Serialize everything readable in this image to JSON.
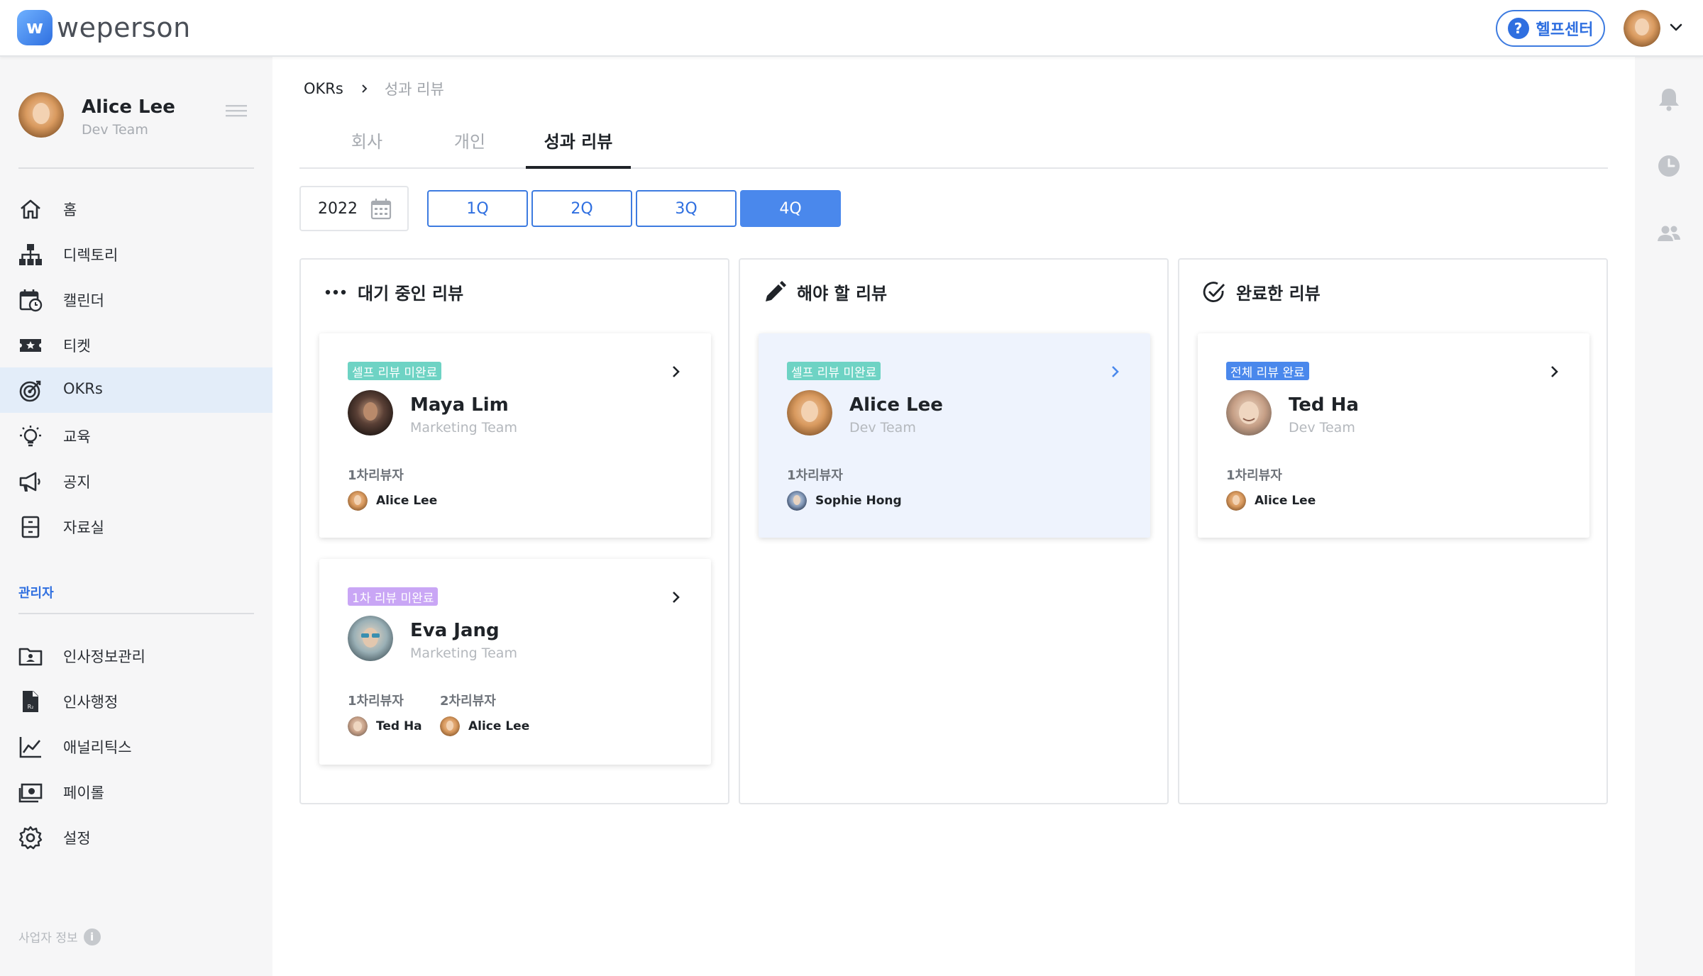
{
  "header": {
    "logo_text": "weperson",
    "help_label": "헬프센터"
  },
  "sidebar": {
    "profile": {
      "name": "Alice Lee",
      "team": "Dev Team"
    },
    "items": [
      {
        "label": "홈",
        "icon": "home-icon"
      },
      {
        "label": "디렉토리",
        "icon": "org-chart-icon"
      },
      {
        "label": "캘린더",
        "icon": "calendar-clock-icon"
      },
      {
        "label": "티켓",
        "icon": "ticket-star-icon"
      },
      {
        "label": "OKRs",
        "icon": "target-icon",
        "active": true
      },
      {
        "label": "교육",
        "icon": "lightbulb-icon"
      },
      {
        "label": "공지",
        "icon": "megaphone-icon"
      },
      {
        "label": "자료실",
        "icon": "cabinet-icon"
      }
    ],
    "admin_section": "관리자",
    "admin_items": [
      {
        "label": "인사정보관리",
        "icon": "id-folder-icon"
      },
      {
        "label": "인사행정",
        "icon": "document-icon"
      },
      {
        "label": "애널리틱스",
        "icon": "line-chart-icon"
      },
      {
        "label": "페이롤",
        "icon": "money-icon"
      },
      {
        "label": "설정",
        "icon": "gear-icon"
      }
    ],
    "footer": "사업자 정보"
  },
  "breadcrumb": {
    "root": "OKRs",
    "current": "성과 리뷰"
  },
  "tabs": [
    {
      "label": "회사"
    },
    {
      "label": "개인"
    },
    {
      "label": "성과 리뷰",
      "active": true
    }
  ],
  "filters": {
    "year": "2022",
    "quarters": [
      "1Q",
      "2Q",
      "3Q",
      "4Q"
    ],
    "selected_quarter": "4Q"
  },
  "columns": [
    {
      "title": "대기 중인 리뷰",
      "icon": "more-dots-icon",
      "cards": [
        {
          "badge": "셀프 리뷰 미완료",
          "badge_color": "#6ed3c4",
          "name": "Maya Lim",
          "team": "Marketing Team",
          "reviewers": [
            {
              "label": "1차리뷰자",
              "name": "Alice Lee"
            }
          ]
        },
        {
          "badge": "1차 리뷰 미완료",
          "badge_color": "#c9a6f5",
          "name": "Eva Jang",
          "team": "Marketing Team",
          "reviewers": [
            {
              "label": "1차리뷰자",
              "name": "Ted Ha"
            },
            {
              "label": "2차리뷰자",
              "name": "Alice Lee"
            }
          ]
        }
      ]
    },
    {
      "title": "해야 할 리뷰",
      "icon": "pencil-icon",
      "cards": [
        {
          "badge": "셀프 리뷰 미완료",
          "badge_color": "#6ed3c4",
          "name": "Alice Lee",
          "team": "Dev Team",
          "reviewers": [
            {
              "label": "1차리뷰자",
              "name": "Sophie Hong"
            }
          ]
        }
      ]
    },
    {
      "title": "완료한 리뷰",
      "icon": "check-circle-icon",
      "cards": [
        {
          "badge": "전체 리뷰 완료",
          "badge_color": "#4a88ec",
          "name": "Ted Ha",
          "team": "Dev Team",
          "reviewers": [
            {
              "label": "1차리뷰자",
              "name": "Alice Lee"
            }
          ]
        }
      ]
    }
  ],
  "colors": {
    "accent": "#2f6fe0",
    "active_nav_bg": "#e3edf9",
    "sidebar_bg": "#f6f6f7"
  }
}
